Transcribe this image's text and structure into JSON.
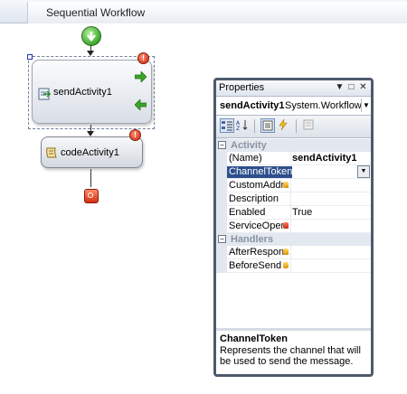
{
  "workflow": {
    "title": "Sequential Workflow",
    "activities": [
      {
        "label": "sendActivity1"
      },
      {
        "label": "codeActivity1"
      }
    ]
  },
  "properties": {
    "title": "Properties",
    "object_name": "sendActivity1",
    "object_type": "System.Workflow.Activities.SendActivity",
    "categories": [
      {
        "label": "Activity",
        "rows": [
          {
            "name": "(Name)",
            "value": "sendActivity1"
          },
          {
            "name": "ChannelToken",
            "value": ""
          },
          {
            "name": "CustomAddress",
            "value": ""
          },
          {
            "name": "Description",
            "value": ""
          },
          {
            "name": "Enabled",
            "value": "True"
          },
          {
            "name": "ServiceOperationInfo",
            "value": ""
          }
        ]
      },
      {
        "label": "Handlers",
        "rows": [
          {
            "name": "AfterResponse",
            "value": ""
          },
          {
            "name": "BeforeSend",
            "value": ""
          }
        ]
      }
    ],
    "description": {
      "title": "ChannelToken",
      "text": "Represents the  channel that will be used to send the message."
    }
  },
  "colors": {
    "selection": "#2e4f8c",
    "window_border": "#4e5a6c",
    "error": "#c8290f"
  }
}
